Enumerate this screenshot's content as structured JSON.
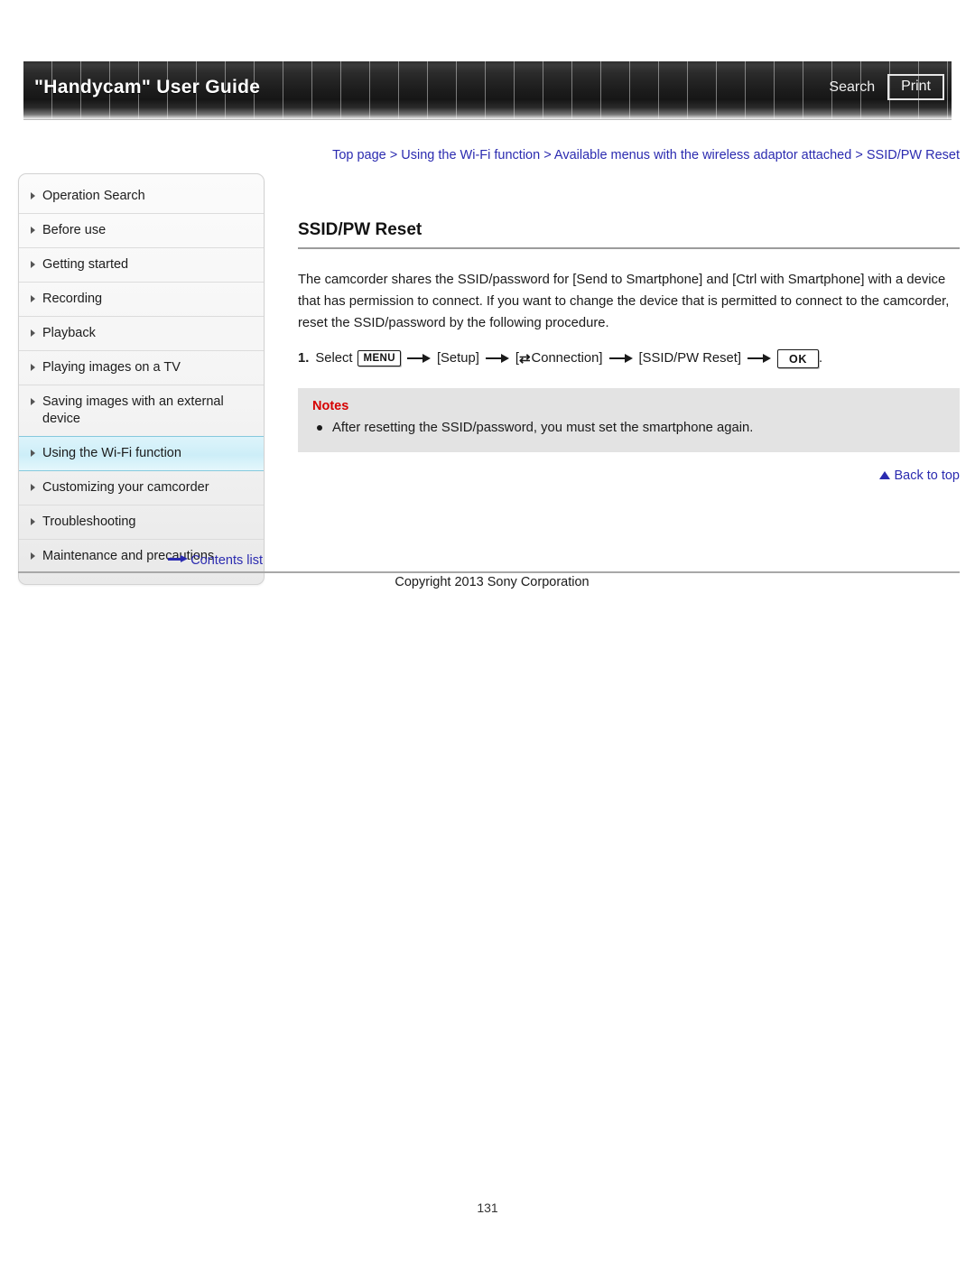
{
  "header": {
    "title": "\"Handycam\" User Guide",
    "search_label": "Search",
    "print_label": "Print"
  },
  "breadcrumb": {
    "items": [
      "Top page",
      "Using the Wi-Fi function",
      "Available menus with the wireless adaptor attached",
      "SSID/PW Reset"
    ],
    "separator": ">",
    "full_text": "Top page > Using the Wi-Fi function > Available menus with the wireless adaptor attached > SSID/PW Reset"
  },
  "sidebar": {
    "items": [
      {
        "label": "Operation Search",
        "active": false
      },
      {
        "label": "Before use",
        "active": false
      },
      {
        "label": "Getting started",
        "active": false
      },
      {
        "label": "Recording",
        "active": false
      },
      {
        "label": "Playback",
        "active": false
      },
      {
        "label": "Playing images on a TV",
        "active": false
      },
      {
        "label": "Saving images with an external device",
        "active": false
      },
      {
        "label": "Using the Wi-Fi function",
        "active": true
      },
      {
        "label": "Customizing your camcorder",
        "active": false
      },
      {
        "label": "Troubleshooting",
        "active": false
      },
      {
        "label": "Maintenance and precautions",
        "active": false
      }
    ],
    "contents_link": "Contents list",
    "active_color": "#cdeef8"
  },
  "main": {
    "title": "SSID/PW Reset",
    "paragraph": "The camcorder shares the SSID/password for [Send to Smartphone] and [Ctrl with Smartphone] with a device that has permission to connect. If you want to change the device that is permitted to connect to the camcorder, reset the SSID/password by the following procedure.",
    "step": {
      "number": "1.",
      "select_label": "Select",
      "menu_button": "MENU",
      "setup_label": "[Setup]",
      "connection_open": "[",
      "connection_icon": "⇄",
      "connection_label": "Connection]",
      "ssid_label": "[SSID/PW Reset]",
      "ok_button": "OK",
      "period": "."
    },
    "notes": {
      "title": "Notes",
      "items": [
        "After resetting the SSID/password, you must set the smartphone again."
      ],
      "title_color": "#d60000",
      "background": "#e3e3e3"
    },
    "back_to_top": "Back to top"
  },
  "footer": {
    "copyright": "Copyright 2013 Sony Corporation",
    "page_number": "131"
  }
}
